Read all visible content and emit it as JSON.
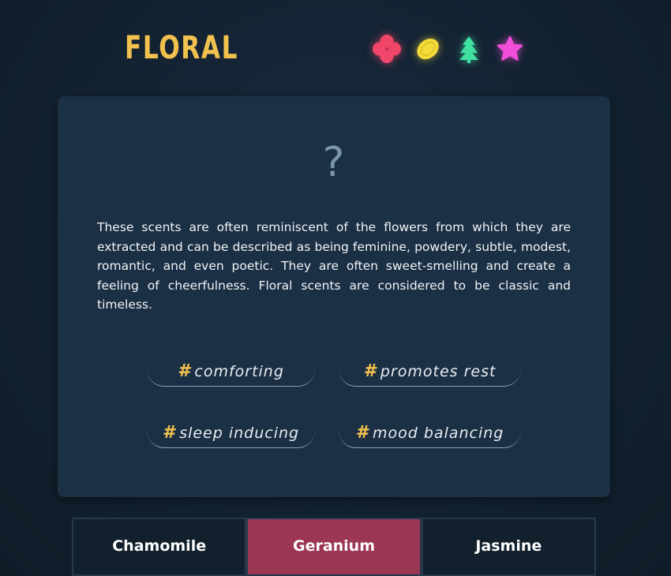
{
  "header": {
    "title": "FLORAL",
    "icons": [
      {
        "name": "flower",
        "color": "#f0466a"
      },
      {
        "name": "lemon",
        "color": "#f3dc3a"
      },
      {
        "name": "tree",
        "color": "#3fe0a0"
      },
      {
        "name": "star",
        "color": "#f04dd8"
      }
    ]
  },
  "card": {
    "question_mark": "?",
    "description": "These scents are often reminiscent of the flowers from which they are extracted and can be described as being feminine, powdery, subtle, modest, romantic, and even poetic. They are often sweet-smelling and create a feeling of cheerfulness. Floral scents are considered to be classic and timeless.",
    "hash": "#",
    "tags": [
      "comforting",
      "promotes rest",
      "sleep inducing",
      "mood balancing"
    ]
  },
  "tabs": [
    {
      "label": "Chamomile",
      "active": false
    },
    {
      "label": "Geranium",
      "active": true
    },
    {
      "label": "Jasmine",
      "active": false
    }
  ],
  "colors": {
    "accent": "#f2c14e",
    "active_tab": "#9b3654",
    "card": "#1b2f45"
  }
}
